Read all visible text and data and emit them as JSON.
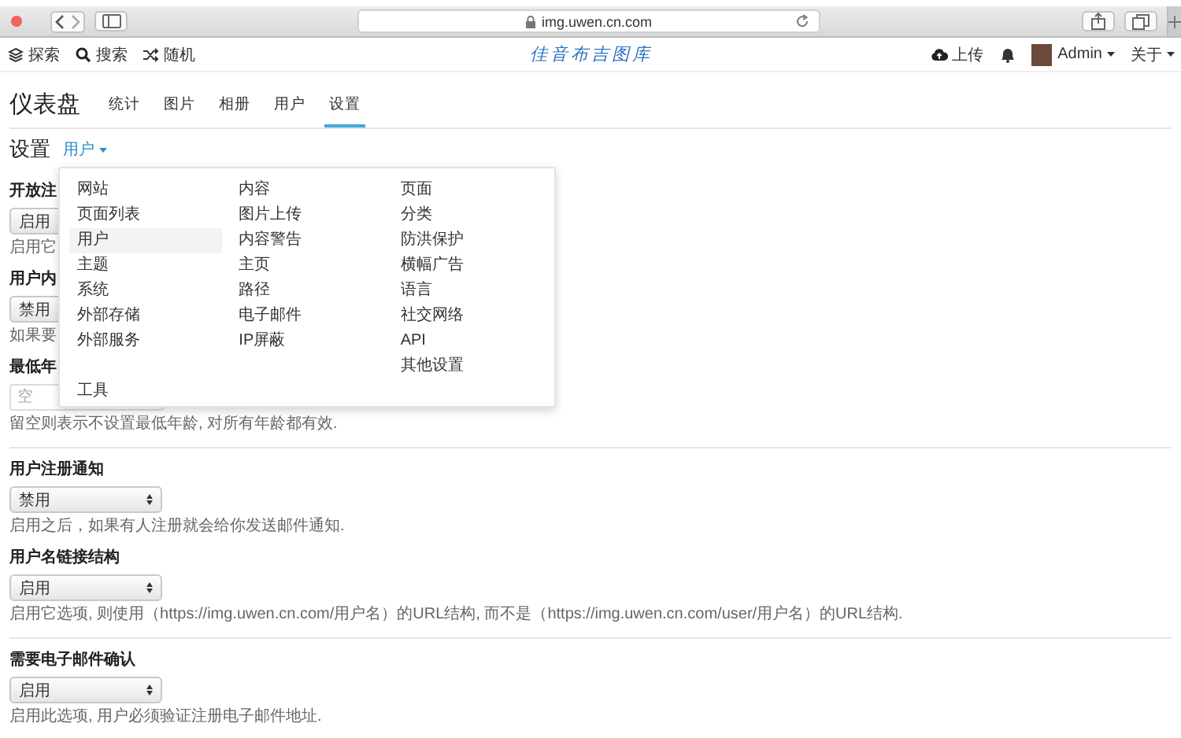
{
  "browser": {
    "url": "img.uwen.cn.com"
  },
  "navbar": {
    "left": [
      {
        "kind": "explore",
        "label": "探索"
      },
      {
        "kind": "search",
        "label": "搜索"
      },
      {
        "kind": "random",
        "label": "随机"
      }
    ],
    "logo": "佳音布吉图库",
    "upload": "上传",
    "user": "Admin",
    "about": "关于"
  },
  "header": {
    "title": "仪表盘",
    "tabs": [
      {
        "label": "统计",
        "selected": false
      },
      {
        "label": "图片",
        "selected": false
      },
      {
        "label": "相册",
        "selected": false
      },
      {
        "label": "用户",
        "selected": false
      },
      {
        "label": "设置",
        "selected": true
      }
    ]
  },
  "settings": {
    "title": "设置",
    "section": "用户",
    "menu": {
      "columns": [
        [
          {
            "label": "网站",
            "selected": false
          },
          {
            "label": "页面列表",
            "selected": false
          },
          {
            "label": "用户",
            "selected": true
          },
          {
            "label": "主题",
            "selected": false
          },
          {
            "label": "系统",
            "selected": false
          },
          {
            "label": "外部存储",
            "selected": false
          },
          {
            "label": "外部服务",
            "selected": false
          }
        ],
        [
          {
            "label": "内容",
            "selected": false
          },
          {
            "label": "图片上传",
            "selected": false
          },
          {
            "label": "内容警告",
            "selected": false
          },
          {
            "label": "主页",
            "selected": false
          },
          {
            "label": "路径",
            "selected": false
          },
          {
            "label": "电子邮件",
            "selected": false
          },
          {
            "label": "IP屏蔽",
            "selected": false
          }
        ],
        [
          {
            "label": "页面",
            "selected": false
          },
          {
            "label": "分类",
            "selected": false
          },
          {
            "label": "防洪保护",
            "selected": false
          },
          {
            "label": "横幅广告",
            "selected": false
          },
          {
            "label": "语言",
            "selected": false
          },
          {
            "label": "社交网络",
            "selected": false
          },
          {
            "label": "API",
            "selected": false
          },
          {
            "label": "其他设置",
            "selected": false
          }
        ]
      ],
      "footer": {
        "label": "工具",
        "selected": false
      }
    },
    "groups": [
      [
        {
          "label": "开放注",
          "control": {
            "kind": "select",
            "value": "启用"
          },
          "help": "启用它"
        },
        {
          "label": "用户内",
          "control": {
            "kind": "select",
            "value": "禁用"
          },
          "help": "如果要"
        },
        {
          "label": "最低年",
          "control": {
            "kind": "input",
            "placeholder": "空"
          },
          "help": "留空则表示不设置最低年龄, 对所有年龄都有效."
        }
      ],
      [
        {
          "label": "用户注册通知",
          "control": {
            "kind": "select",
            "value": "禁用"
          },
          "help": "启用之后，如果有人注册就会给你发送邮件通知."
        },
        {
          "label": "用户名链接结构",
          "control": {
            "kind": "select",
            "value": "启用"
          },
          "help": "启用它选项, 则使用（https://img.uwen.cn.com/用户名）的URL结构, 而不是（https://img.uwen.cn.com/user/用户名）的URL结构."
        }
      ],
      [
        {
          "label": "需要电子邮件确认",
          "control": {
            "kind": "select",
            "value": "启用"
          },
          "help": "启用此选项, 用户必须验证注册电子邮件地址."
        }
      ]
    ]
  }
}
